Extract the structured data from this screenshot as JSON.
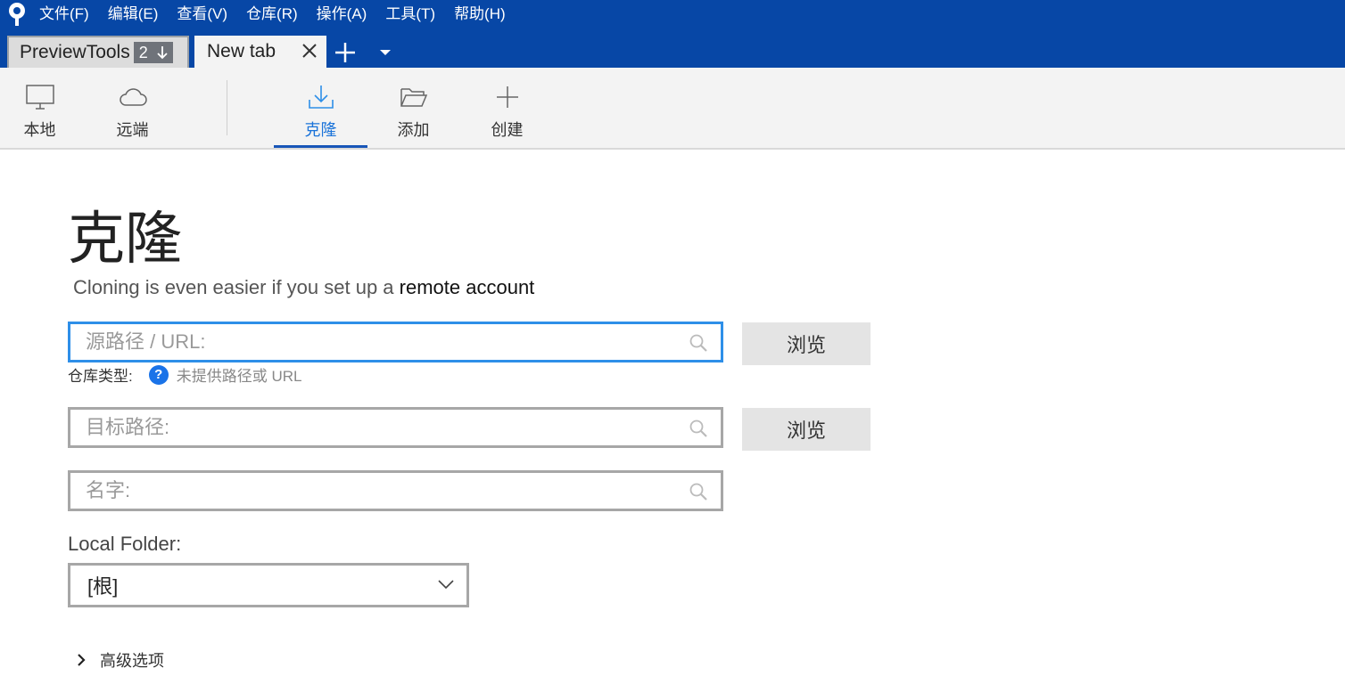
{
  "menubar": {
    "items": [
      "文件(F)",
      "编辑(E)",
      "查看(V)",
      "仓库(R)",
      "操作(A)",
      "工具(T)",
      "帮助(H)"
    ]
  },
  "tabs": [
    {
      "label": "PreviewTools",
      "badge_count": "2"
    },
    {
      "label": "New tab"
    }
  ],
  "toolbar": {
    "local": "本地",
    "remote": "远端",
    "clone": "克隆",
    "add": "添加",
    "create": "创建"
  },
  "clone": {
    "title": "克隆",
    "subtitle_prefix": "Cloning is even easier if you set up a ",
    "subtitle_link": "remote account",
    "source_placeholder": "源路径 / URL:",
    "browse_label": "浏览",
    "repo_type_label": "仓库类型:",
    "repo_type_help": "?",
    "repo_type_hint": "未提供路径或 URL",
    "dest_placeholder": "目标路径:",
    "name_placeholder": "名字:",
    "local_folder_label": "Local Folder:",
    "local_folder_value": "[根]",
    "advanced_label": "高级选项"
  },
  "colors": {
    "menubar_bg": "#0747a6",
    "accent": "#1a73d9",
    "focus_border": "#2e8fe8"
  }
}
